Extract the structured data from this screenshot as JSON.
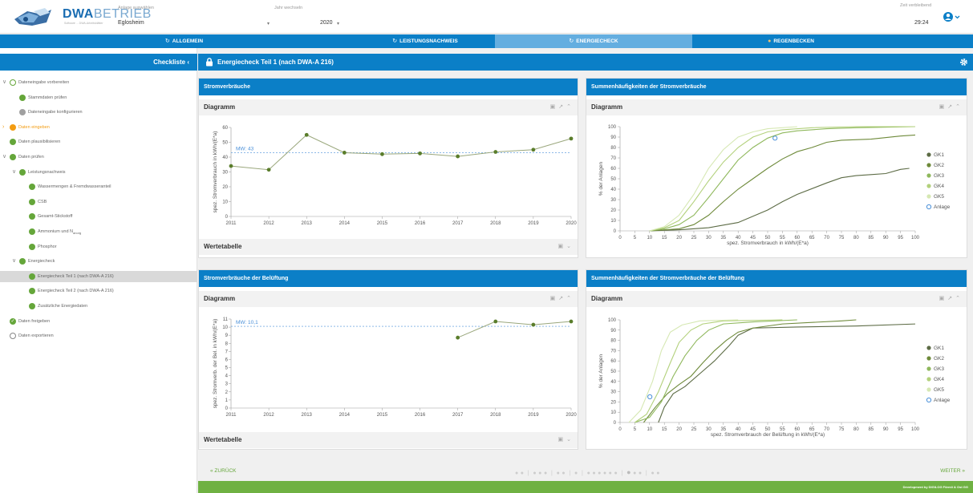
{
  "header": {
    "logo_main": "DWA",
    "logo_secondary": "BETRIEB",
    "logo_sub": "Software ... DWA-Arbeitsblätter",
    "anlage_label": "Anlage auswählen",
    "anlage_value": "Eglosheim",
    "jahr_label": "Jahr wechseln",
    "jahr_value": "2020",
    "zeit_label": "Zeit verbleibend",
    "zeit_value": "29:24",
    "user_icon": "user-circle-icon"
  },
  "nav": {
    "tabs": [
      {
        "label": "ALLGEMEIN",
        "icon": "↻",
        "active": false
      },
      {
        "label": "LEISTUNGSNACHWEIS",
        "icon": "↻",
        "active": false
      },
      {
        "label": "ENERGIECHECK",
        "icon": "↻",
        "active": true
      },
      {
        "label": "REGENBECKEN",
        "icon": "●",
        "active": false
      }
    ]
  },
  "sidebar": {
    "title": "Checkliste",
    "items": [
      {
        "label": "Dateneingabe vorbereiten",
        "state": "ring-green",
        "level": 0,
        "caret": "∨"
      },
      {
        "label": "Stammdaten prüfen",
        "state": "green",
        "level": 1
      },
      {
        "label": "Dateneingabe konfigurieren",
        "state": "gray",
        "level": 1
      },
      {
        "label": "Daten eingeben",
        "state": "orange",
        "level": 0,
        "caret": "›"
      },
      {
        "label": "Daten plausibilisieren",
        "state": "green",
        "level": 0
      },
      {
        "label": "Daten prüfen",
        "state": "green",
        "level": 0,
        "caret": "∨"
      },
      {
        "label": "Leistungsnachweis",
        "state": "green",
        "level": 1,
        "caret": "∨"
      },
      {
        "label": "Wassermengen & Fremdwasseranteil",
        "state": "green",
        "level": 2
      },
      {
        "label": "CSB",
        "state": "green",
        "level": 2
      },
      {
        "label": "Gesamt-Stickstoff",
        "state": "green",
        "level": 2
      },
      {
        "label": "Ammonium und N",
        "sub": "anorg",
        "state": "green",
        "level": 2
      },
      {
        "label": "Phosphor",
        "state": "green",
        "level": 2
      },
      {
        "label": "Energiecheck",
        "state": "green",
        "level": 1,
        "caret": "∨"
      },
      {
        "label": "Energiecheck Teil 1 (nach DWA-A 216)",
        "state": "green",
        "level": 2,
        "selected": true
      },
      {
        "label": "Energiecheck Teil 2 (nach DWA-A 216)",
        "state": "green",
        "level": 2
      },
      {
        "label": "Zusätzliche Energiedaten",
        "state": "green",
        "level": 2
      },
      {
        "label": "Daten freigeben",
        "state": "check",
        "level": 0
      },
      {
        "label": "Daten exportieren",
        "state": "ring",
        "level": 0
      }
    ]
  },
  "main": {
    "title": "Energiecheck Teil 1 (nach DWA-A 216)",
    "panels": [
      {
        "title": "Stromverbräuche",
        "sub_title": "Diagramm",
        "table_title": "Wertetabelle"
      },
      {
        "title": "Summenhäufigkeiten der Stromverbräuche",
        "sub_title": "Diagramm"
      },
      {
        "title": "Stromverbräuche der Belüftung",
        "sub_title": "Diagramm",
        "table_title": "Wertetabelle"
      },
      {
        "title": "Summenhäufigkeiten der Stromverbräuche der Belüftung",
        "sub_title": "Diagramm"
      }
    ]
  },
  "footer": {
    "back_label": "« ZURÜCK",
    "next_label": "WEITER »",
    "credit": "Development by DIGILOG Förmli & Ost GG"
  },
  "colors": {
    "primary": "#0b7fc7",
    "primary_light": "#64aee0",
    "green": "#65a63a",
    "series_dark": "#5a7d2b",
    "mean_line": "#4a90d9"
  },
  "chart_data": [
    {
      "type": "line",
      "title": "",
      "xlabel": "",
      "ylabel": "spez. Stromverbrauch in kWh/(E*a)",
      "x": [
        2011,
        2012,
        2013,
        2014,
        2015,
        2016,
        2017,
        2018,
        2019,
        2020
      ],
      "series": [
        {
          "values": [
            34,
            31.5,
            55,
            43,
            42,
            42.5,
            40.5,
            43.5,
            45,
            52.5
          ]
        }
      ],
      "ylim": [
        0,
        60
      ],
      "yticks": [
        0,
        10,
        20,
        30,
        40,
        50,
        60
      ],
      "mean": {
        "label": "MW: 43",
        "value": 43
      },
      "grid": false
    },
    {
      "type": "line",
      "title": "",
      "xlabel": "spez. Stromverbrauch in kWh/(E*a)",
      "ylabel": "% der Anlagen",
      "xlim": [
        0,
        100
      ],
      "ylim": [
        0,
        100
      ],
      "xticks": [
        0,
        5,
        10,
        15,
        20,
        25,
        30,
        35,
        40,
        45,
        50,
        55,
        60,
        65,
        70,
        75,
        80,
        85,
        90,
        95,
        100
      ],
      "yticks": [
        0,
        10,
        20,
        30,
        40,
        50,
        60,
        70,
        80,
        90,
        100
      ],
      "legend": "right",
      "series": [
        {
          "name": "GK1",
          "color": "#5c6b45",
          "points": [
            [
              10,
              0
            ],
            [
              20,
              1
            ],
            [
              30,
              3
            ],
            [
              40,
              8
            ],
            [
              50,
              20
            ],
            [
              55,
              28
            ],
            [
              60,
              35
            ],
            [
              70,
              46
            ],
            [
              75,
              51
            ],
            [
              80,
              53
            ],
            [
              85,
              54
            ],
            [
              90,
              55
            ],
            [
              95,
              59
            ],
            [
              98,
              60
            ]
          ]
        },
        {
          "name": "GK2",
          "color": "#6e8a3a",
          "points": [
            [
              10,
              0
            ],
            [
              20,
              2
            ],
            [
              25,
              6
            ],
            [
              30,
              15
            ],
            [
              35,
              28
            ],
            [
              40,
              40
            ],
            [
              45,
              50
            ],
            [
              50,
              60
            ],
            [
              55,
              69
            ],
            [
              60,
              76
            ],
            [
              65,
              80
            ],
            [
              70,
              85
            ],
            [
              75,
              87
            ],
            [
              85,
              88
            ],
            [
              95,
              91
            ],
            [
              100,
              92
            ]
          ]
        },
        {
          "name": "GK3",
          "color": "#8fb85c",
          "points": [
            [
              10,
              0
            ],
            [
              15,
              2
            ],
            [
              20,
              6
            ],
            [
              25,
              15
            ],
            [
              30,
              32
            ],
            [
              35,
              50
            ],
            [
              40,
              68
            ],
            [
              45,
              80
            ],
            [
              50,
              89
            ],
            [
              55,
              94
            ],
            [
              60,
              96
            ],
            [
              70,
              98
            ],
            [
              80,
              99
            ],
            [
              100,
              100
            ]
          ]
        },
        {
          "name": "GK4",
          "color": "#b3d17c",
          "points": [
            [
              10,
              0
            ],
            [
              15,
              3
            ],
            [
              20,
              10
            ],
            [
              25,
              28
            ],
            [
              30,
              48
            ],
            [
              35,
              66
            ],
            [
              40,
              80
            ],
            [
              45,
              90
            ],
            [
              50,
              95
            ],
            [
              55,
              97
            ],
            [
              65,
              99
            ],
            [
              80,
              100
            ],
            [
              100,
              100
            ]
          ]
        },
        {
          "name": "GK5",
          "color": "#d6e8b3",
          "points": [
            [
              10,
              0
            ],
            [
              15,
              4
            ],
            [
              20,
              15
            ],
            [
              25,
              35
            ],
            [
              30,
              60
            ],
            [
              35,
              78
            ],
            [
              40,
              90
            ],
            [
              45,
              95
            ],
            [
              50,
              98
            ],
            [
              60,
              100
            ]
          ]
        }
      ],
      "marker": {
        "name": "Anlage",
        "x": 52.5,
        "y": 89
      }
    },
    {
      "type": "line",
      "title": "",
      "xlabel": "",
      "ylabel": "spez. Stromverb. der Bel. in kWh/(E*a)",
      "x": [
        2011,
        2012,
        2013,
        2014,
        2015,
        2016,
        2017,
        2018,
        2019,
        2020
      ],
      "series": [
        {
          "values": [
            null,
            null,
            null,
            null,
            null,
            null,
            8.7,
            10.7,
            10.3,
            10.7
          ]
        }
      ],
      "ylim": [
        0,
        11
      ],
      "yticks": [
        0,
        1,
        2,
        3,
        4,
        5,
        6,
        7,
        8,
        9,
        10,
        11
      ],
      "mean": {
        "label": "MW: 10,1",
        "value": 10.1
      },
      "grid": false
    },
    {
      "type": "line",
      "title": "",
      "xlabel": "spez. Stromverbrauch der Belüftung in kWh/(E*a)",
      "ylabel": "% der Anlagen",
      "xlim": [
        0,
        100
      ],
      "ylim": [
        0,
        100
      ],
      "xticks": [
        0,
        5,
        10,
        15,
        20,
        25,
        30,
        35,
        40,
        45,
        50,
        55,
        60,
        65,
        70,
        75,
        80,
        85,
        90,
        95,
        100
      ],
      "yticks": [
        0,
        10,
        20,
        30,
        40,
        50,
        60,
        70,
        80,
        90,
        100
      ],
      "legend": "right",
      "series": [
        {
          "name": "GK1",
          "color": "#5c6b45",
          "points": [
            [
              13,
              0
            ],
            [
              15,
              15
            ],
            [
              18,
              28
            ],
            [
              22,
              35
            ],
            [
              28,
              50
            ],
            [
              32,
              60
            ],
            [
              37,
              75
            ],
            [
              40,
              85
            ],
            [
              45,
              92
            ],
            [
              60,
              93
            ],
            [
              80,
              94
            ],
            [
              100,
              96
            ]
          ]
        },
        {
          "name": "GK2",
          "color": "#6e8a3a",
          "points": [
            [
              8,
              0
            ],
            [
              12,
              15
            ],
            [
              16,
              28
            ],
            [
              20,
              37
            ],
            [
              24,
              45
            ],
            [
              28,
              58
            ],
            [
              32,
              70
            ],
            [
              36,
              80
            ],
            [
              40,
              88
            ],
            [
              45,
              92
            ],
            [
              55,
              96
            ],
            [
              75,
              99
            ],
            [
              80,
              100
            ]
          ]
        },
        {
          "name": "GK3",
          "color": "#8fb85c",
          "points": [
            [
              5,
              0
            ],
            [
              10,
              5
            ],
            [
              14,
              20
            ],
            [
              18,
              45
            ],
            [
              22,
              65
            ],
            [
              26,
              80
            ],
            [
              30,
              90
            ],
            [
              35,
              96
            ],
            [
              45,
              98
            ],
            [
              60,
              100
            ]
          ]
        },
        {
          "name": "GK4",
          "color": "#b3d17c",
          "points": [
            [
              5,
              0
            ],
            [
              9,
              8
            ],
            [
              13,
              30
            ],
            [
              17,
              58
            ],
            [
              20,
              78
            ],
            [
              24,
              90
            ],
            [
              28,
              96
            ],
            [
              35,
              99
            ],
            [
              55,
              100
            ]
          ]
        },
        {
          "name": "GK5",
          "color": "#d6e8b3",
          "points": [
            [
              3,
              0
            ],
            [
              7,
              12
            ],
            [
              11,
              40
            ],
            [
              14,
              70
            ],
            [
              17,
              88
            ],
            [
              21,
              95
            ],
            [
              27,
              99
            ],
            [
              40,
              100
            ]
          ]
        }
      ],
      "marker": {
        "name": "Anlage",
        "x": 10.1,
        "y": 25
      }
    }
  ]
}
